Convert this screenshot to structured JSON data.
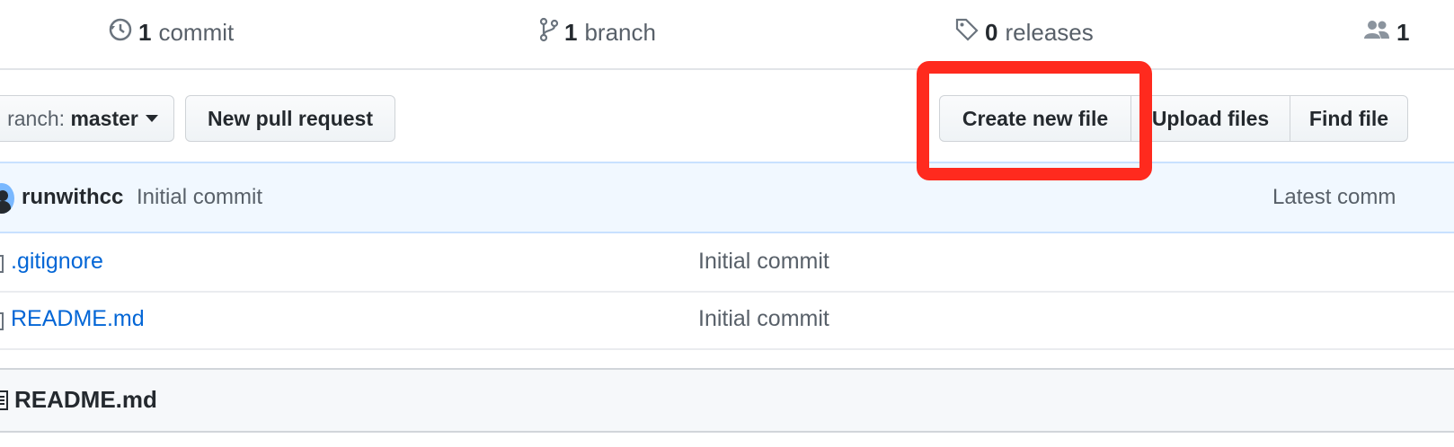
{
  "summary": {
    "commits": {
      "count": "1",
      "label": "commit",
      "icon": "history-icon"
    },
    "branches": {
      "count": "1",
      "label": "branch",
      "icon": "git-branch-icon"
    },
    "releases": {
      "count": "0",
      "label": "releases",
      "icon": "tag-icon"
    },
    "contributors": {
      "count": "1",
      "icon": "people-icon"
    }
  },
  "toolbar": {
    "branch_prefix": "ranch:",
    "branch_name": "master",
    "new_pull_request": "New pull request",
    "create_new_file": "Create new file",
    "upload_files": "Upload files",
    "find_file": "Find file"
  },
  "commit_bar": {
    "author": "runwithcc",
    "message": "Initial commit",
    "latest": "Latest comm"
  },
  "files": [
    {
      "name": ".gitignore",
      "message": "Initial commit"
    },
    {
      "name": "README.md",
      "message": "Initial commit"
    }
  ],
  "readme": {
    "title": "README.md",
    "icon": "book-icon"
  },
  "colors": {
    "highlight": "#ff2a1e",
    "link": "#0366d6",
    "commit_bar_bg": "#f1f8ff"
  }
}
